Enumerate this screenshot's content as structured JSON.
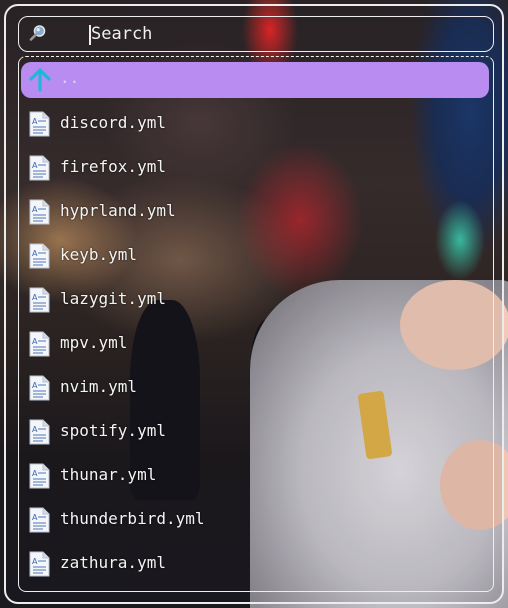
{
  "search": {
    "placeholder": "Search",
    "value": ""
  },
  "list": {
    "items": [
      {
        "label": "..",
        "icon": "arrow-up-icon",
        "selected": true
      },
      {
        "label": "discord.yml",
        "icon": "text-file-icon"
      },
      {
        "label": "firefox.yml",
        "icon": "text-file-icon"
      },
      {
        "label": "hyprland.yml",
        "icon": "text-file-icon"
      },
      {
        "label": "keyb.yml",
        "icon": "text-file-icon"
      },
      {
        "label": "lazygit.yml",
        "icon": "text-file-icon"
      },
      {
        "label": "mpv.yml",
        "icon": "text-file-icon"
      },
      {
        "label": "nvim.yml",
        "icon": "text-file-icon"
      },
      {
        "label": "spotify.yml",
        "icon": "text-file-icon"
      },
      {
        "label": "thunar.yml",
        "icon": "text-file-icon"
      },
      {
        "label": "thunderbird.yml",
        "icon": "text-file-icon"
      },
      {
        "label": "zathura.yml",
        "icon": "text-file-icon"
      }
    ]
  },
  "colors": {
    "selection": "#b98cf2",
    "border": "#eeeeee",
    "up_arrow": "#1fb6d9"
  }
}
